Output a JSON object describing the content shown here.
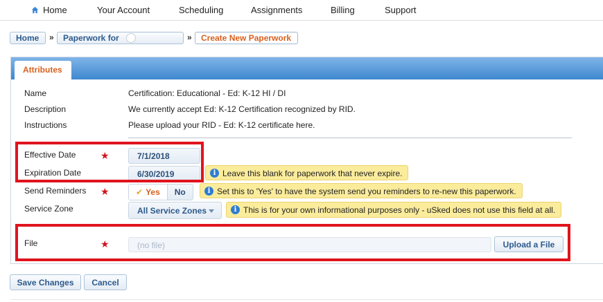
{
  "nav": {
    "items": [
      "Home",
      "Your Account",
      "Scheduling",
      "Assignments",
      "Billing",
      "Support"
    ]
  },
  "breadcrumb": {
    "home": "Home",
    "paperwork_for": "Paperwork for",
    "current": "Create New Paperwork"
  },
  "panel": {
    "tab": "Attributes"
  },
  "details": {
    "name_label": "Name",
    "name_value": "Certification: Educational - Ed: K-12 HI / DI",
    "description_label": "Description",
    "description_value": "We currently accept Ed: K-12 Certification recognized by RID.",
    "instructions_label": "Instructions",
    "instructions_value": "Please upload your RID - Ed: K-12 certificate here."
  },
  "form": {
    "effective_date_label": "Effective Date",
    "effective_date_value": "7/1/2018",
    "expiration_date_label": "Expiration Date",
    "expiration_date_value": "6/30/2019",
    "expiration_hint": "Leave this blank for paperwork that never expire.",
    "send_reminders_label": "Send Reminders",
    "reminders_yes": "Yes",
    "reminders_no": "No",
    "reminders_hint": "Set this to 'Yes' to have the system send you reminders to re-new this paperwork.",
    "service_zone_label": "Service Zone",
    "service_zone_value": "All Service Zones",
    "service_zone_hint": "This is for your own informational purposes only - uSked does not use this field at all.",
    "file_label": "File",
    "file_placeholder": "(no file)",
    "upload_button": "Upload a File",
    "required_mark": "★",
    "info_glyph": "i"
  },
  "actions": {
    "save": "Save Changes",
    "cancel": "Cancel"
  },
  "colors": {
    "accent": "#d8601e",
    "link": "#2c5a8c",
    "header_blue": "#3f87cf",
    "required": "#d0141f",
    "hint_bg": "#fbec9c",
    "highlight": "#e0141e"
  },
  "icons": {
    "home": "home-icon",
    "info": "info-icon",
    "check": "check-icon",
    "caret": "chevron-down-icon",
    "required": "star-icon"
  }
}
